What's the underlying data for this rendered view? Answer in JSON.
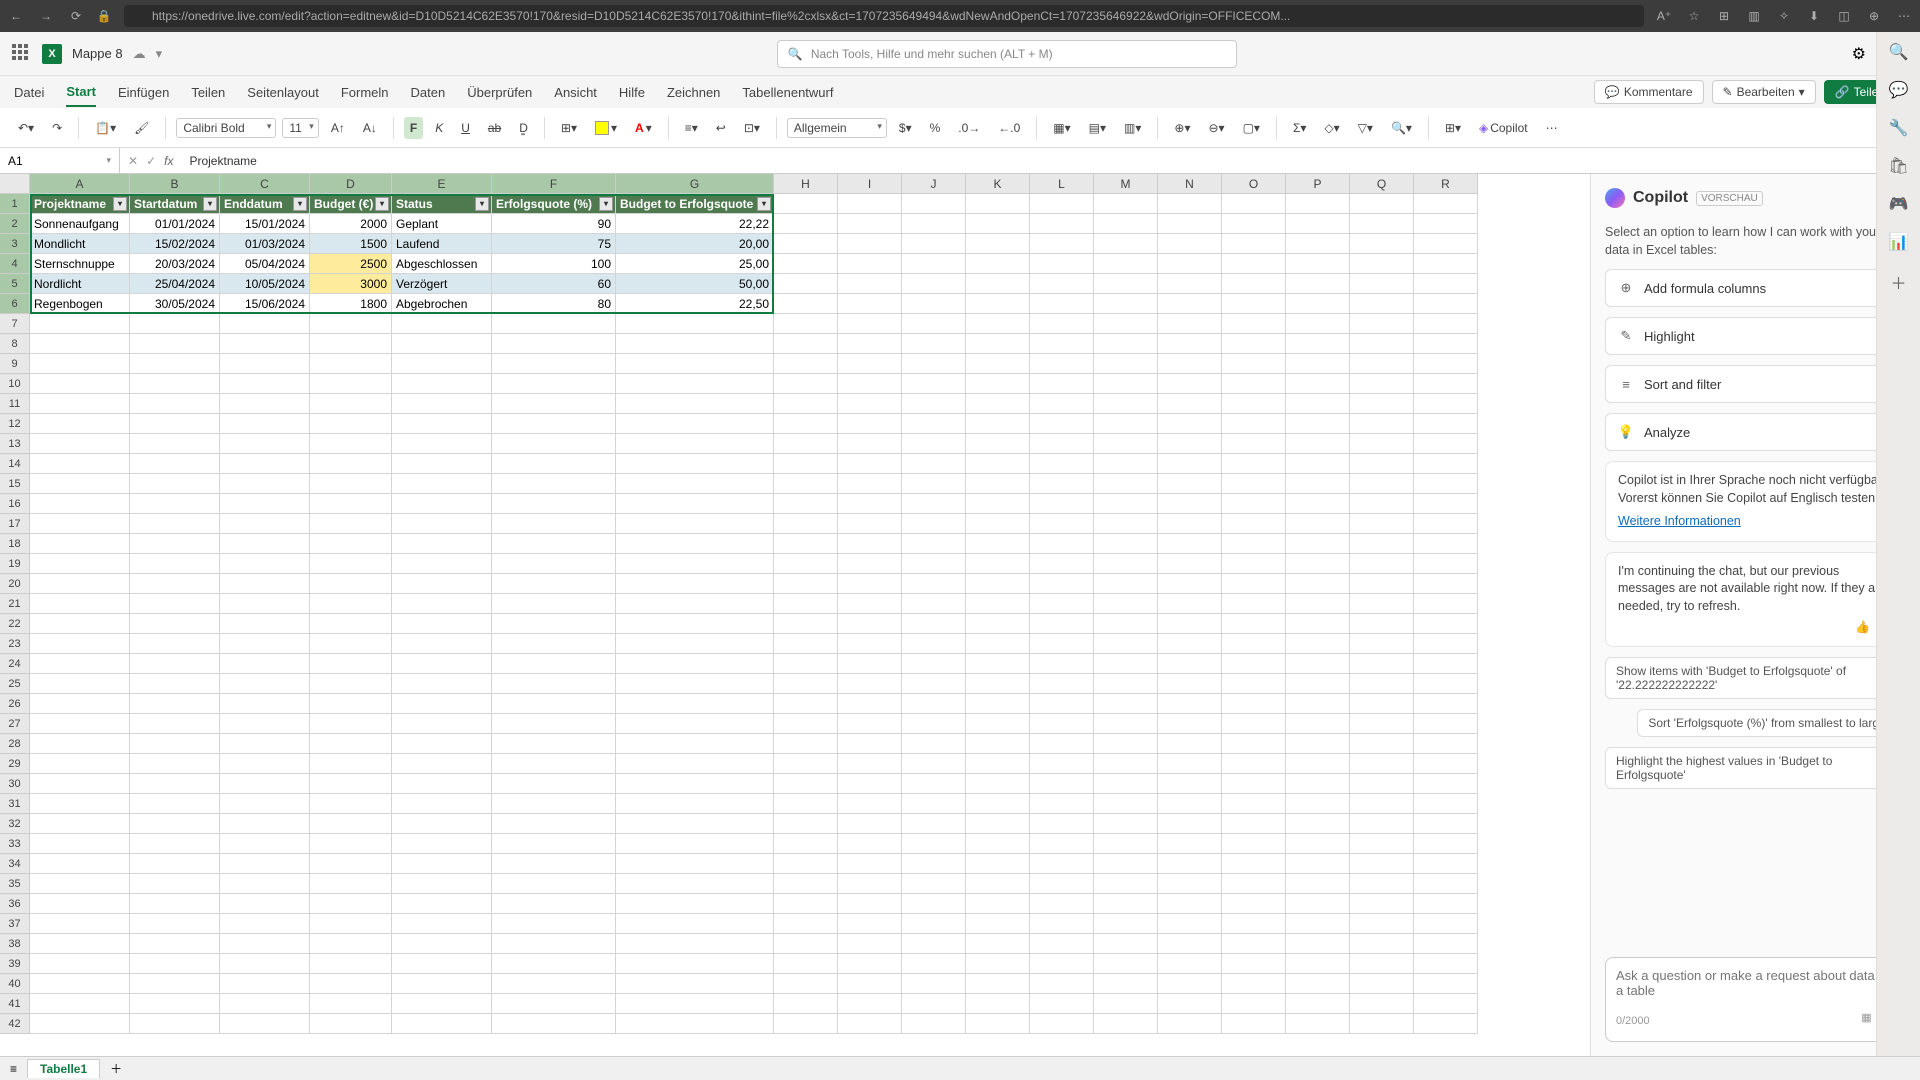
{
  "browser": {
    "url": "https://onedrive.live.com/edit?action=editnew&id=D10D5214C62E3570!170&resid=D10D5214C62E3570!170&ithint=file%2cxlsx&ct=1707235649494&wdNewAndOpenCt=1707235646922&wdOrigin=OFFICECOM..."
  },
  "title": {
    "doc_name": "Mappe 8",
    "search_placeholder": "Nach Tools, Hilfe und mehr suchen (ALT + M)"
  },
  "tabs": {
    "items": [
      "Datei",
      "Start",
      "Einfügen",
      "Teilen",
      "Seitenlayout",
      "Formeln",
      "Daten",
      "Überprüfen",
      "Ansicht",
      "Hilfe",
      "Zeichnen",
      "Tabellenentwurf"
    ],
    "active": "Start",
    "comments": "Kommentare",
    "editing": "Bearbeiten",
    "share": "Teilen"
  },
  "toolbar": {
    "font": "Calibri Bold",
    "size": "11",
    "number_format": "Allgemein",
    "copilot": "Copilot"
  },
  "formula": {
    "name_box": "A1",
    "formula_text": "Projektname"
  },
  "sheet": {
    "columns": [
      "A",
      "B",
      "C",
      "D",
      "E",
      "F",
      "G",
      "H",
      "I",
      "J",
      "K",
      "L",
      "M",
      "N",
      "O",
      "P",
      "Q",
      "R"
    ],
    "headers": [
      "Projektname",
      "Startdatum",
      "Enddatum",
      "Budget (€)",
      "Status",
      "Erfolgsquote (%)",
      "Budget to Erfolgsquote"
    ],
    "rows": [
      {
        "name": "Sonnenaufgang",
        "start": "01/01/2024",
        "end": "15/01/2024",
        "budget": "2000",
        "status": "Geplant",
        "quote": "90",
        "ratio": "22,22"
      },
      {
        "name": "Mondlicht",
        "start": "15/02/2024",
        "end": "01/03/2024",
        "budget": "1500",
        "status": "Laufend",
        "quote": "75",
        "ratio": "20,00"
      },
      {
        "name": "Sternschnuppe",
        "start": "20/03/2024",
        "end": "05/04/2024",
        "budget": "2500",
        "status": "Abgeschlossen",
        "quote": "100",
        "ratio": "25,00"
      },
      {
        "name": "Nordlicht",
        "start": "25/04/2024",
        "end": "10/05/2024",
        "budget": "3000",
        "status": "Verzögert",
        "quote": "60",
        "ratio": "50,00"
      },
      {
        "name": "Regenbogen",
        "start": "30/05/2024",
        "end": "15/06/2024",
        "budget": "1800",
        "status": "Abgebrochen",
        "quote": "80",
        "ratio": "22,50"
      }
    ],
    "sheet_tab": "Tabelle1"
  },
  "copilot": {
    "title": "Copilot",
    "badge": "VORSCHAU",
    "intro": "Select an option to learn how I can work with your data in Excel tables:",
    "options": {
      "add": "Add formula columns",
      "highlight": "Highlight",
      "sort": "Sort and filter",
      "analyze": "Analyze"
    },
    "lang_msg": "Copilot ist in Ihrer Sprache noch nicht verfügbar. Vorerst können Sie Copilot auf Englisch testen.",
    "lang_link": "Weitere Informationen",
    "continuing": "I'm continuing the chat, but our previous messages are not available right now. If they are needed, try to refresh.",
    "sugg1": "Show items with 'Budget to Erfolgsquote' of '22.222222222222'",
    "sugg2": "Sort 'Erfolgsquote (%)' from smallest to largest",
    "sugg3": "Highlight the highest values in 'Budget to Erfolgsquote'",
    "input_placeholder": "Ask a question or make a request about data in a table",
    "counter": "0/2000"
  }
}
